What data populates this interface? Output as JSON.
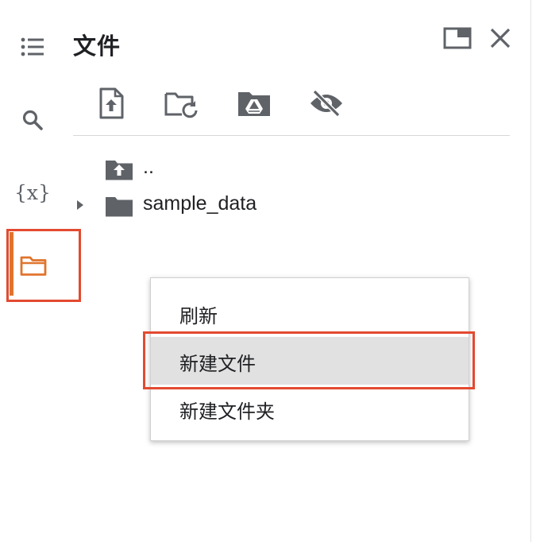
{
  "panel": {
    "title": "文件"
  },
  "side_rail": {
    "variables_label": "{x}",
    "active_accent_color": "#e0742c",
    "highlight_color": "#e34a30"
  },
  "header_icons": [
    "expand-panel-icon",
    "close-icon"
  ],
  "toolbar": {
    "icons": [
      "upload-file-icon",
      "refresh-folder-icon",
      "google-drive-icon",
      "hide-files-icon"
    ]
  },
  "tree": {
    "items": [
      {
        "label": "..",
        "icon": "folder-up-icon"
      },
      {
        "label": "sample_data",
        "icon": "folder-icon",
        "expandable": true
      }
    ]
  },
  "context_menu": {
    "items": [
      {
        "label": "刷新"
      },
      {
        "label": "新建文件",
        "hovered": true
      },
      {
        "label": "新建文件夹"
      }
    ]
  }
}
